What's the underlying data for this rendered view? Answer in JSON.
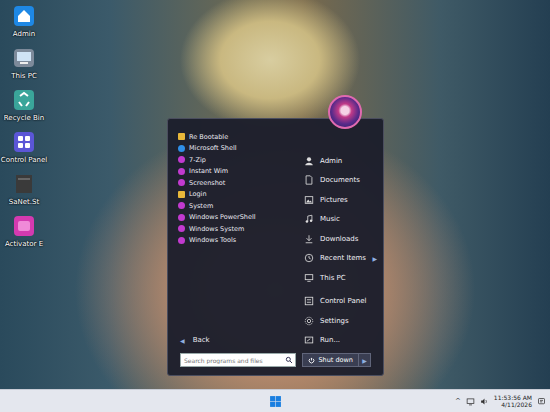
{
  "desktop_icons": [
    {
      "label": "Admin"
    },
    {
      "label": "This PC"
    },
    {
      "label": "Recycle Bin"
    },
    {
      "label": "Control Panel"
    },
    {
      "label": "SaNet.St"
    },
    {
      "label": "Activator E"
    }
  ],
  "start_menu": {
    "programs": [
      {
        "label": "Re Bootable",
        "kind": "folder"
      },
      {
        "label": "Microsoft Shell",
        "kind": "edge"
      },
      {
        "label": "7-Zip",
        "kind": "app"
      },
      {
        "label": "Instant Wim",
        "kind": "app"
      },
      {
        "label": "Screenshot",
        "kind": "app"
      },
      {
        "label": "Login",
        "kind": "folder"
      },
      {
        "label": "System",
        "kind": "app"
      },
      {
        "label": "Windows PowerShell",
        "kind": "app"
      },
      {
        "label": "Windows System",
        "kind": "app"
      },
      {
        "label": "Windows Tools",
        "kind": "app"
      }
    ],
    "places": [
      {
        "kind": "link",
        "label": "Admin"
      },
      {
        "kind": "link",
        "label": "Documents"
      },
      {
        "kind": "link",
        "label": "Pictures"
      },
      {
        "kind": "link",
        "label": "Music"
      },
      {
        "kind": "link",
        "label": "Downloads"
      },
      {
        "kind": "link",
        "label": "Recent Items",
        "arrow": "▶"
      },
      {
        "kind": "link",
        "label": "This PC"
      },
      {
        "kind": "separator"
      },
      {
        "kind": "link",
        "label": "Control Panel"
      },
      {
        "kind": "link",
        "label": "Settings"
      },
      {
        "kind": "link",
        "label": "Run..."
      }
    ],
    "back": {
      "icon": "◀",
      "label": "Back"
    },
    "search": {
      "placeholder": "Search programs and files"
    },
    "shutdown": {
      "label": "Shut down",
      "arrow": "▶"
    }
  },
  "taskbar": {
    "tray_arrow": "^",
    "time": "11:53:56 AM",
    "date": "4/11/2026"
  }
}
